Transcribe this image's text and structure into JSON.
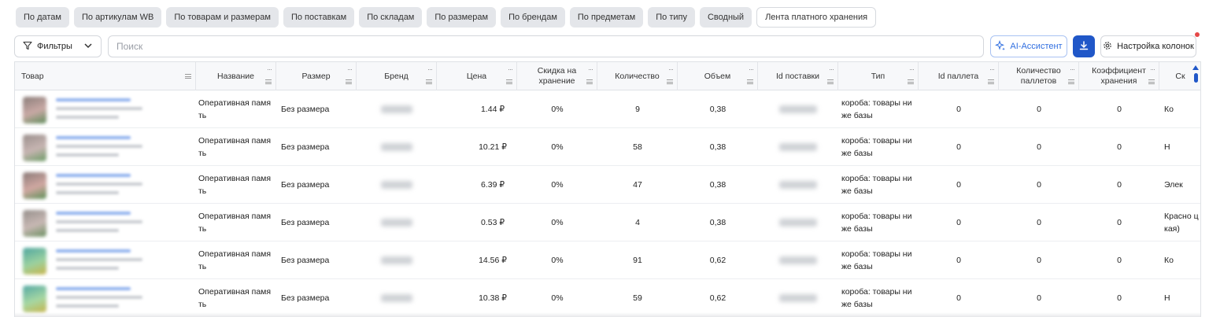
{
  "tabs": [
    {
      "label": "По датам",
      "active": false
    },
    {
      "label": "По артикулам WB",
      "active": false
    },
    {
      "label": "По товарам и размерам",
      "active": false
    },
    {
      "label": "По поставкам",
      "active": false
    },
    {
      "label": "По складам",
      "active": false
    },
    {
      "label": "По размерам",
      "active": false
    },
    {
      "label": "По брендам",
      "active": false
    },
    {
      "label": "По предметам",
      "active": false
    },
    {
      "label": "По типу",
      "active": false
    },
    {
      "label": "Сводный",
      "active": false
    },
    {
      "label": "Лента платного хранения",
      "active": true
    }
  ],
  "toolbar": {
    "filters_label": "Фильтры",
    "search_placeholder": "Поиск",
    "ai_label": "AI-Ассистент",
    "columns_label": "Настройка колонок"
  },
  "columns": [
    "Товар",
    "Название",
    "Размер",
    "Бренд",
    "Цена",
    "Скидка на хранение",
    "Количество",
    "Объем",
    "Id поставки",
    "Тип",
    "Id паллета",
    "Количество паллетов",
    "Коэффициент хранения",
    "Ск"
  ],
  "rows": [
    {
      "name": "Оперативная память",
      "size": "Без размера",
      "price": "1.44 ₽",
      "discount": "0%",
      "qty": "9",
      "volume": "0,38",
      "type": "короба: товары ниже базы",
      "pallet_id": "0",
      "pallets": "0",
      "coef": "0",
      "warehouse": "Ко"
    },
    {
      "name": "Оперативная память",
      "size": "Без размера",
      "price": "10.21 ₽",
      "discount": "0%",
      "qty": "58",
      "volume": "0,38",
      "type": "короба: товары ниже базы",
      "pallet_id": "0",
      "pallets": "0",
      "coef": "0",
      "warehouse": "Н"
    },
    {
      "name": "Оперативная память",
      "size": "Без размера",
      "price": "6.39 ₽",
      "discount": "0%",
      "qty": "47",
      "volume": "0,38",
      "type": "короба: товары ниже базы",
      "pallet_id": "0",
      "pallets": "0",
      "coef": "0",
      "warehouse": "Элек"
    },
    {
      "name": "Оперативная память",
      "size": "Без размера",
      "price": "0.53 ₽",
      "discount": "0%",
      "qty": "4",
      "volume": "0,38",
      "type": "короба: товары ниже базы",
      "pallet_id": "0",
      "pallets": "0",
      "coef": "0",
      "warehouse": "Красно цкая)"
    },
    {
      "name": "Оперативная память",
      "size": "Без размера",
      "price": "14.56 ₽",
      "discount": "0%",
      "qty": "91",
      "volume": "0,62",
      "type": "короба: товары ниже базы",
      "pallet_id": "0",
      "pallets": "0",
      "coef": "0",
      "warehouse": "Ко"
    },
    {
      "name": "Оперативная память",
      "size": "Без размера",
      "price": "10.38 ₽",
      "discount": "0%",
      "qty": "59",
      "volume": "0,62",
      "type": "короба: товары ниже базы",
      "pallet_id": "0",
      "pallets": "0",
      "coef": "0",
      "warehouse": "Н"
    }
  ],
  "colors": {
    "accent": "#2057c8",
    "ai": "#2f6ee0",
    "link": "#8fb0ee",
    "notify": "#e54848"
  },
  "icons": {
    "filter": "funnel-icon",
    "ai": "sparkle-icon",
    "download": "download-icon",
    "settings": "gear-icon"
  }
}
